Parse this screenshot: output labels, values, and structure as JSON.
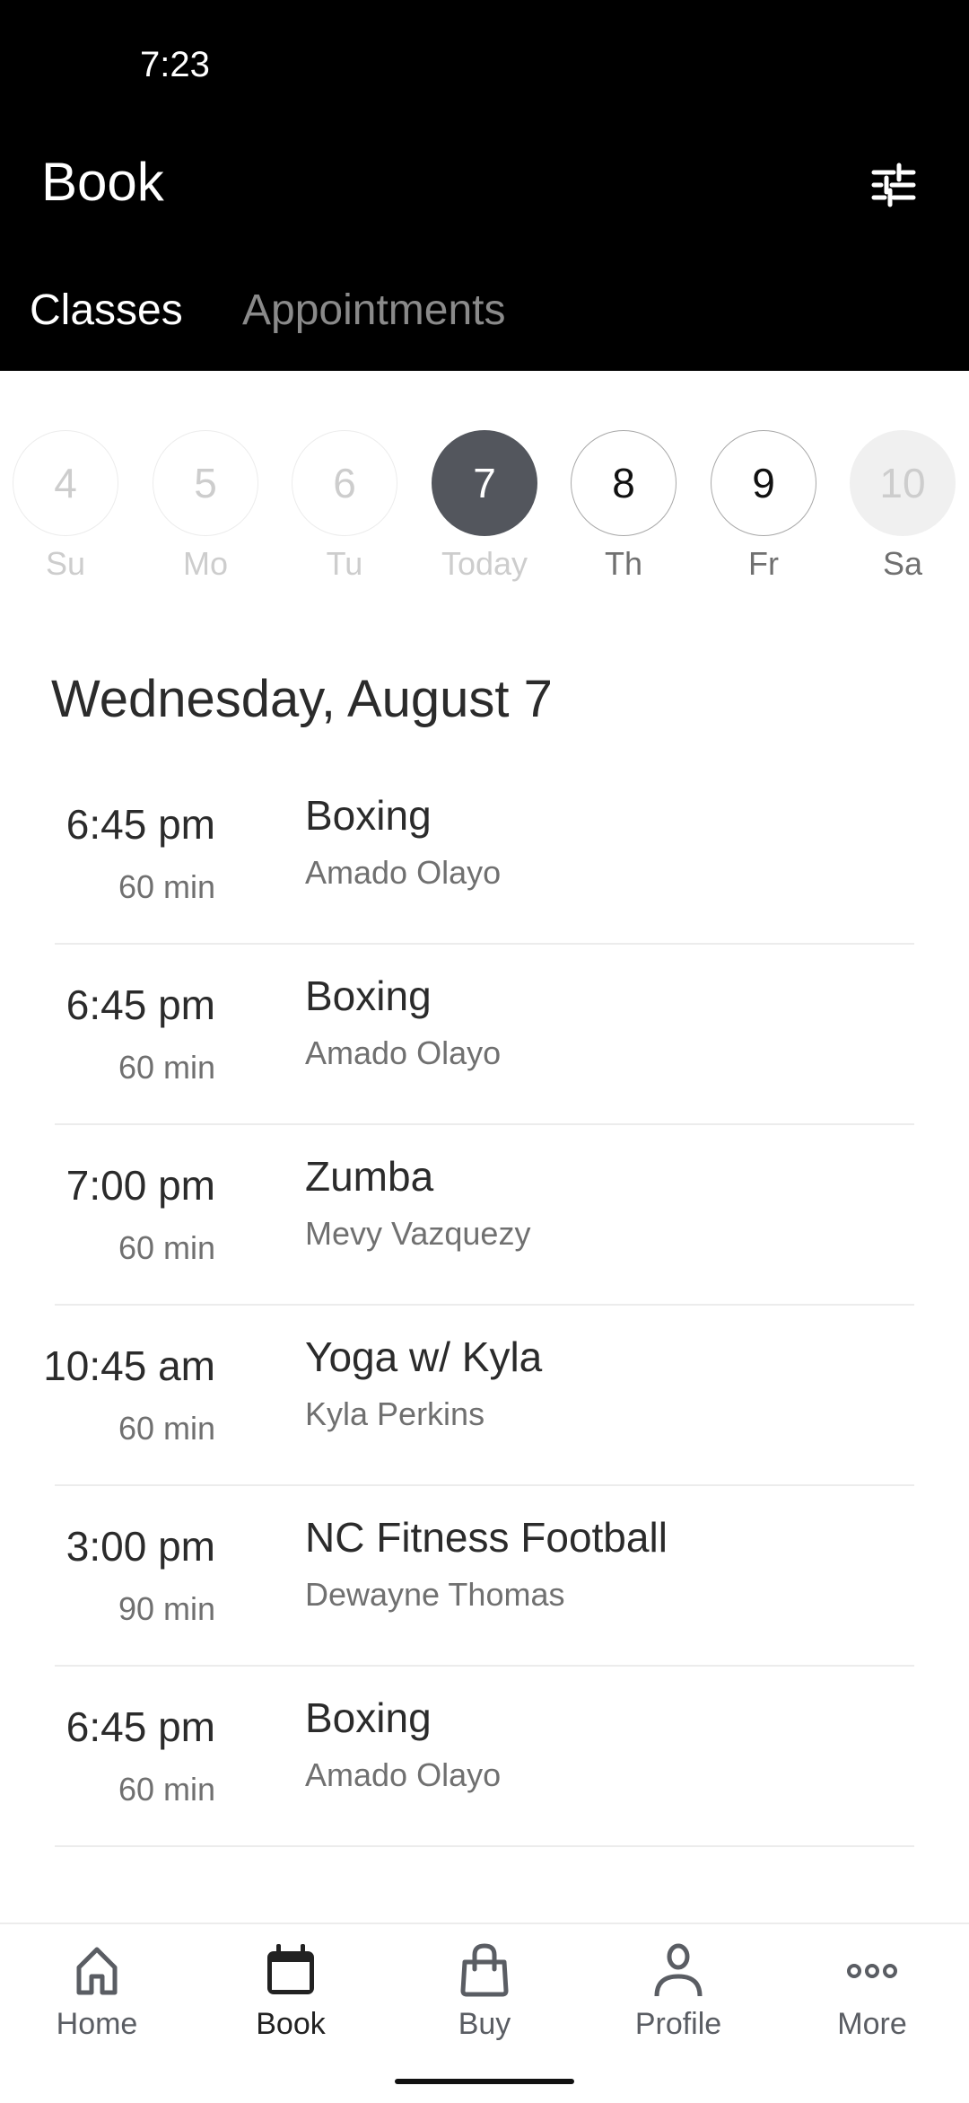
{
  "status_bar": {
    "time": "7:23"
  },
  "header": {
    "title": "Book",
    "filter_icon": "sliders-icon"
  },
  "tabs": [
    {
      "label": "Classes",
      "active": true
    },
    {
      "label": "Appointments",
      "active": false
    }
  ],
  "days": [
    {
      "number": "4",
      "label": "Su",
      "state": "past"
    },
    {
      "number": "5",
      "label": "Mo",
      "state": "past"
    },
    {
      "number": "6",
      "label": "Tu",
      "state": "past"
    },
    {
      "number": "7",
      "label": "Today",
      "state": "selected"
    },
    {
      "number": "8",
      "label": "Th",
      "state": "future"
    },
    {
      "number": "9",
      "label": "Fr",
      "state": "future"
    },
    {
      "number": "10",
      "label": "Sa",
      "state": "unavailable"
    }
  ],
  "date_heading": "Wednesday, August 7",
  "classes": [
    {
      "time": "6:45 pm",
      "duration": "60 min",
      "name": "Boxing",
      "instructor": "Amado Olayo"
    },
    {
      "time": "6:45 pm",
      "duration": "60 min",
      "name": "Boxing",
      "instructor": "Amado Olayo"
    },
    {
      "time": "7:00 pm",
      "duration": "60 min",
      "name": "Zumba",
      "instructor": "Mevy Vazquezy"
    },
    {
      "time": "10:45 am",
      "duration": "60 min",
      "name": "Yoga w/ Kyla",
      "instructor": "Kyla Perkins"
    },
    {
      "time": "3:00 pm",
      "duration": "90 min",
      "name": "NC Fitness Football",
      "instructor": "Dewayne Thomas"
    },
    {
      "time": "6:45 pm",
      "duration": "60 min",
      "name": "Boxing",
      "instructor": "Amado Olayo"
    }
  ],
  "bottom_nav": [
    {
      "label": "Home",
      "icon": "home-icon",
      "active": false
    },
    {
      "label": "Book",
      "icon": "calendar-icon",
      "active": true
    },
    {
      "label": "Buy",
      "icon": "shopping-bag-icon",
      "active": false
    },
    {
      "label": "Profile",
      "icon": "person-icon",
      "active": false
    },
    {
      "label": "More",
      "icon": "more-dots-icon",
      "active": false
    }
  ],
  "colors": {
    "header_bg": "#000000",
    "selected_day": "#53565d",
    "divider": "#ececec"
  }
}
